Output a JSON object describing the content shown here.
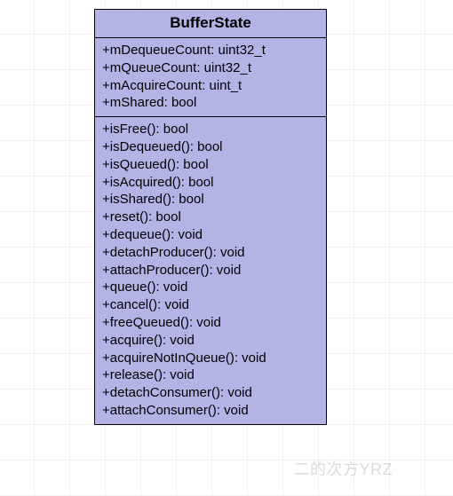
{
  "class": {
    "name": "BufferState",
    "attributes": [
      "+mDequeueCount: uint32_t",
      "+mQueueCount: uint32_t",
      "+mAcquireCount: uint_t",
      "+mShared: bool"
    ],
    "operations": [
      "+isFree(): bool",
      "+isDequeued(): bool",
      "+isQueued(): bool",
      "+isAcquired(): bool",
      "+isShared(): bool",
      "+reset(): bool",
      "+dequeue(): void",
      "+detachProducer(): void",
      "+attachProducer(): void",
      "+queue(): void",
      "+cancel(): void",
      "+freeQueued(): void",
      "+acquire(): void",
      "+acquireNotInQueue(): void",
      "+release(): void",
      "+detachConsumer(): void",
      "+attachConsumer(): void"
    ]
  },
  "watermark": "二的次方YRZ"
}
